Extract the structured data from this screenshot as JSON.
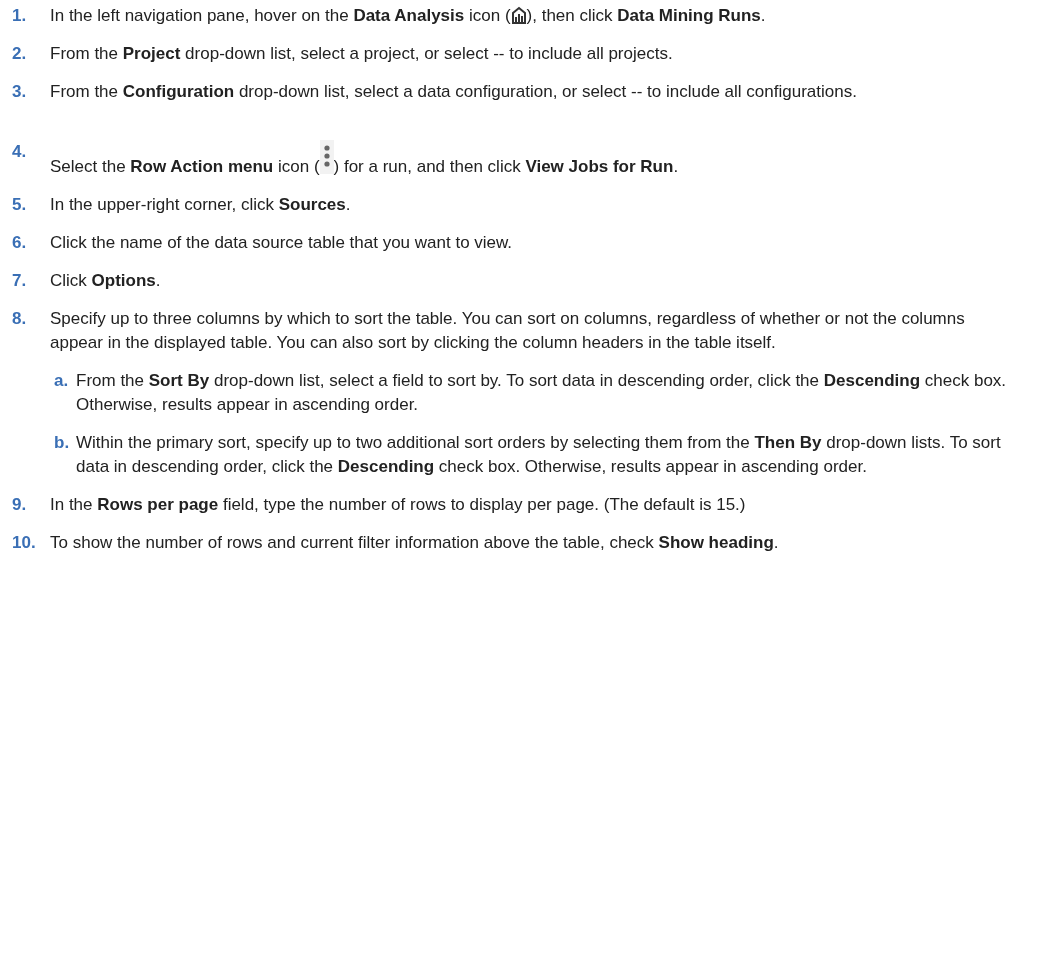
{
  "steps": [
    {
      "number": "1.",
      "parts": [
        {
          "kind": "text",
          "text": "In the left navigation pane, hover on the **Data Analysis** icon ("
        },
        {
          "kind": "analysis-icon"
        },
        {
          "kind": "text",
          "text": "), then click **Data Mining Runs**."
        }
      ]
    },
    {
      "number": "2.",
      "parts": [
        {
          "kind": "text",
          "text": "From the **Project** drop-down list, select a project, or select -- to include all projects."
        }
      ]
    },
    {
      "number": "3.",
      "parts": [
        {
          "kind": "text",
          "text": "From the **Configuration** drop-down list, select a data configuration, or select -- to include all configurations."
        }
      ]
    },
    {
      "number": "4.",
      "parts": [
        {
          "kind": "text",
          "text": "Select the **Row Action menu** icon ("
        },
        {
          "kind": "menu-icon"
        },
        {
          "kind": "text",
          "text": ") for a run, and then click **View Jobs for Run**."
        }
      ]
    },
    {
      "number": "5.",
      "parts": [
        {
          "kind": "text",
          "text": "In the upper-right corner, click **Sources**."
        }
      ]
    },
    {
      "number": "6.",
      "parts": [
        {
          "kind": "text",
          "text": "Click the name of the data source table that you want to view."
        }
      ]
    },
    {
      "number": "7.",
      "parts": [
        {
          "kind": "text",
          "text": "Click **Options**."
        }
      ]
    },
    {
      "number": "8.",
      "parts": [
        {
          "kind": "text",
          "text": "Specify up to three columns by which to sort the table. You can sort on columns, regardless of whether or not the columns appear in the displayed table. You can also sort by clicking the column headers in the table itself."
        }
      ],
      "substeps": [
        {
          "number": "a.",
          "text": "From the **Sort By** drop-down list, select a field to sort by. To sort data in descending order, click the **Descending** check box. Otherwise, results appear in ascending order."
        },
        {
          "number": "b.",
          "text": "Within the primary sort, specify up to two additional sort orders by selecting them from the **Then By** drop-down lists. To sort data in descending order, click the **Descending** check box. Otherwise, results appear in ascending order."
        }
      ]
    },
    {
      "number": "9.",
      "parts": [
        {
          "kind": "text",
          "text": "In the **Rows per page** field, type the number of rows to display per page. (The default is 15.)"
        }
      ]
    },
    {
      "number": "10.",
      "parts": [
        {
          "kind": "text",
          "text": "To show the number of rows and current filter information above the table, check **Show heading**."
        }
      ]
    }
  ]
}
